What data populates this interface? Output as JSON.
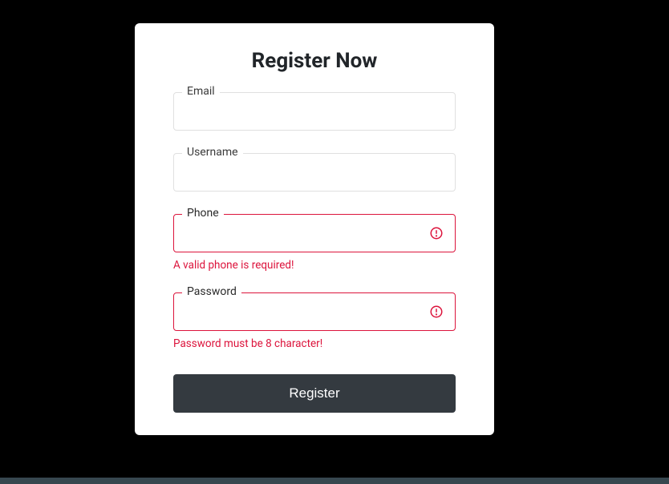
{
  "title": "Register Now",
  "fields": {
    "email": {
      "label": "Email",
      "value": ""
    },
    "username": {
      "label": "Username",
      "value": ""
    },
    "phone": {
      "label": "Phone",
      "value": "",
      "error": "A valid phone is required!"
    },
    "password": {
      "label": "Password",
      "value": "",
      "error": "Password must be 8 character!"
    }
  },
  "submit_label": "Register",
  "colors": {
    "error": "#dc143c",
    "button_bg": "#343a40",
    "card_bg": "#ffffff",
    "page_bg": "#000000"
  }
}
